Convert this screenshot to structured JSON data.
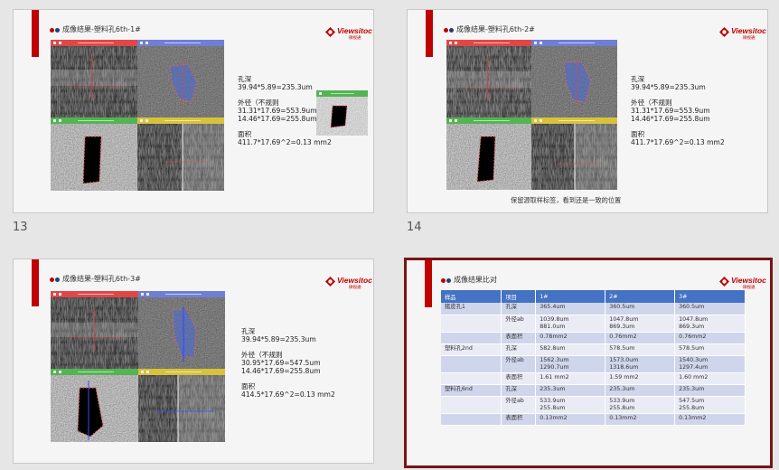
{
  "logo": {
    "brand": "Viewsitoc",
    "sub": "微视通"
  },
  "slides": [
    {
      "number": "13",
      "title": "成像结果-塑料孔6th-1#",
      "info": {
        "depth_label": "孔深",
        "depth_value": "39.94*5.89=235.3um",
        "outer_label": "外径（不规则",
        "outer_line1": "31.31*17.69=553.9um",
        "outer_line2": "14.46*17.69=255.8um",
        "area_label": "面积",
        "area_value": "411.7*17.69^2=0.13 mm2"
      }
    },
    {
      "number": "14",
      "title": "成像结果-塑料孔6th-2#",
      "info": {
        "depth_label": "孔深",
        "depth_value": "39.94*5.89=235.3um",
        "outer_label": "外径（不规则",
        "outer_line1": "31.31*17.69=553.9um",
        "outer_line2": "14.46*17.69=255.8um",
        "area_label": "面积",
        "area_value": "411.7*17.69^2=0.13 mm2"
      },
      "caption": "保留源取样标签，看到还是一致的位置"
    },
    {
      "number": "",
      "title": "成像结果-塑料孔6th-3#",
      "info": {
        "depth_label": "孔深",
        "depth_value": "39.94*5.89=235.3um",
        "outer_label": "外径（不规则",
        "outer_line1": "30.95*17.69=547.5um",
        "outer_line2": "14.46*17.69=255.8um",
        "area_label": "面积",
        "area_value": "414.5*17.69^2=0.13 mm2"
      }
    },
    {
      "number": "",
      "title": "成像结果比对",
      "table": {
        "headers": [
          "样品",
          "项目",
          "1#",
          "2#",
          "3#"
        ],
        "rows": [
          {
            "c": [
              "猪皮孔1",
              "孔深",
              "365.4um",
              "360.5um",
              "360.5um"
            ]
          },
          {
            "c": [
              "",
              "外径ab",
              "1039.8um\n881.0um",
              "1047.8um\n869.3um",
              "1047.8um\n869.3um"
            ]
          },
          {
            "c": [
              "",
              "表面积",
              "0.78mm2",
              "0.76mm2",
              "0.76mm2"
            ]
          },
          {
            "c": [
              "塑料孔2nd",
              "孔深",
              "582.8um",
              "578.5um",
              "578.5um"
            ]
          },
          {
            "c": [
              "",
              "外径ab",
              "1562.3um\n1290.7um",
              "1573.0um\n1318.6um",
              "1540.3um\n1297.4um"
            ]
          },
          {
            "c": [
              "",
              "表面积",
              "1.61 mm2",
              "1.59 mm2",
              "1.60 mm2"
            ]
          },
          {
            "c": [
              "塑料孔6nd",
              "孔深",
              "235.3um",
              "235.3um",
              "235.3um"
            ]
          },
          {
            "c": [
              "",
              "外径ab",
              "533.9um\n255.8um",
              "533.9um\n255.8um",
              "547.5um\n255.8um"
            ]
          },
          {
            "c": [
              "",
              "表面积",
              "0.13mm2",
              "0.13mm2",
              "0.13mm2"
            ]
          }
        ]
      }
    }
  ],
  "colors": {
    "accent_red": "#c00000",
    "accent_navy": "#1f3f7a",
    "table_header": "#4472c4",
    "selected_border": "#7a1414"
  }
}
